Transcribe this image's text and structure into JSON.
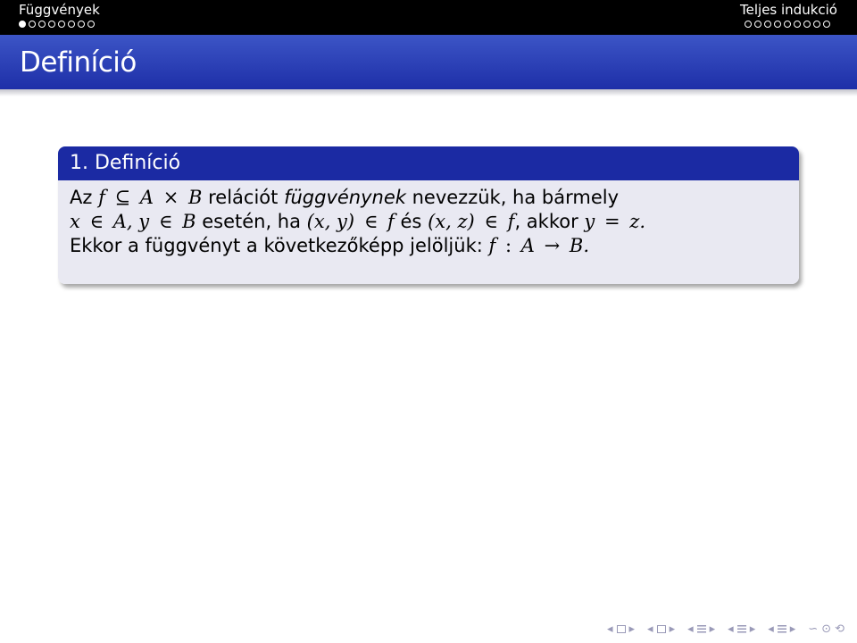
{
  "header": {
    "section_left": "Függvények",
    "section_right": "Teljes indukció",
    "nav_dots_left": [
      true,
      false,
      false,
      false,
      false,
      false,
      false,
      false
    ],
    "nav_dots_right": [
      false,
      false,
      false,
      false,
      false,
      false,
      false,
      false,
      false
    ]
  },
  "frame": {
    "title": "Definíció"
  },
  "definition": {
    "heading": "1. Definíció",
    "line1": {
      "t1": "Az",
      "m1": "f",
      "op1": "⊆",
      "m2": "A",
      "op2": "×",
      "m3": "B",
      "t2": "relációt",
      "emph": "függvénynek",
      "t3": "nevezzük, ha bármely"
    },
    "line2": {
      "m1": "x",
      "op1": "∈",
      "m2": "A, y",
      "op2": "∈",
      "m3": "B",
      "t1": "esetén, ha",
      "m4": "(x, y)",
      "op3": "∈",
      "m5": "f",
      "t2": "és",
      "m6": "(x, z)",
      "op4": "∈",
      "m7": "f",
      "t3": ", akkor",
      "m8": "y",
      "op5": "=",
      "m9": "z."
    },
    "line3": {
      "t1": "Ekkor a függvényt a következőképp jelöljük:",
      "m1": "f",
      "op1": ":",
      "m2": "A",
      "op2": "→",
      "m3": "B."
    }
  },
  "navigation": {
    "symbols": [
      "◂",
      "▸",
      "◂",
      "▸",
      "◂",
      "▸",
      "◂",
      "▸",
      "◂",
      "▸",
      "∽",
      "⊙",
      "⟲"
    ]
  }
}
